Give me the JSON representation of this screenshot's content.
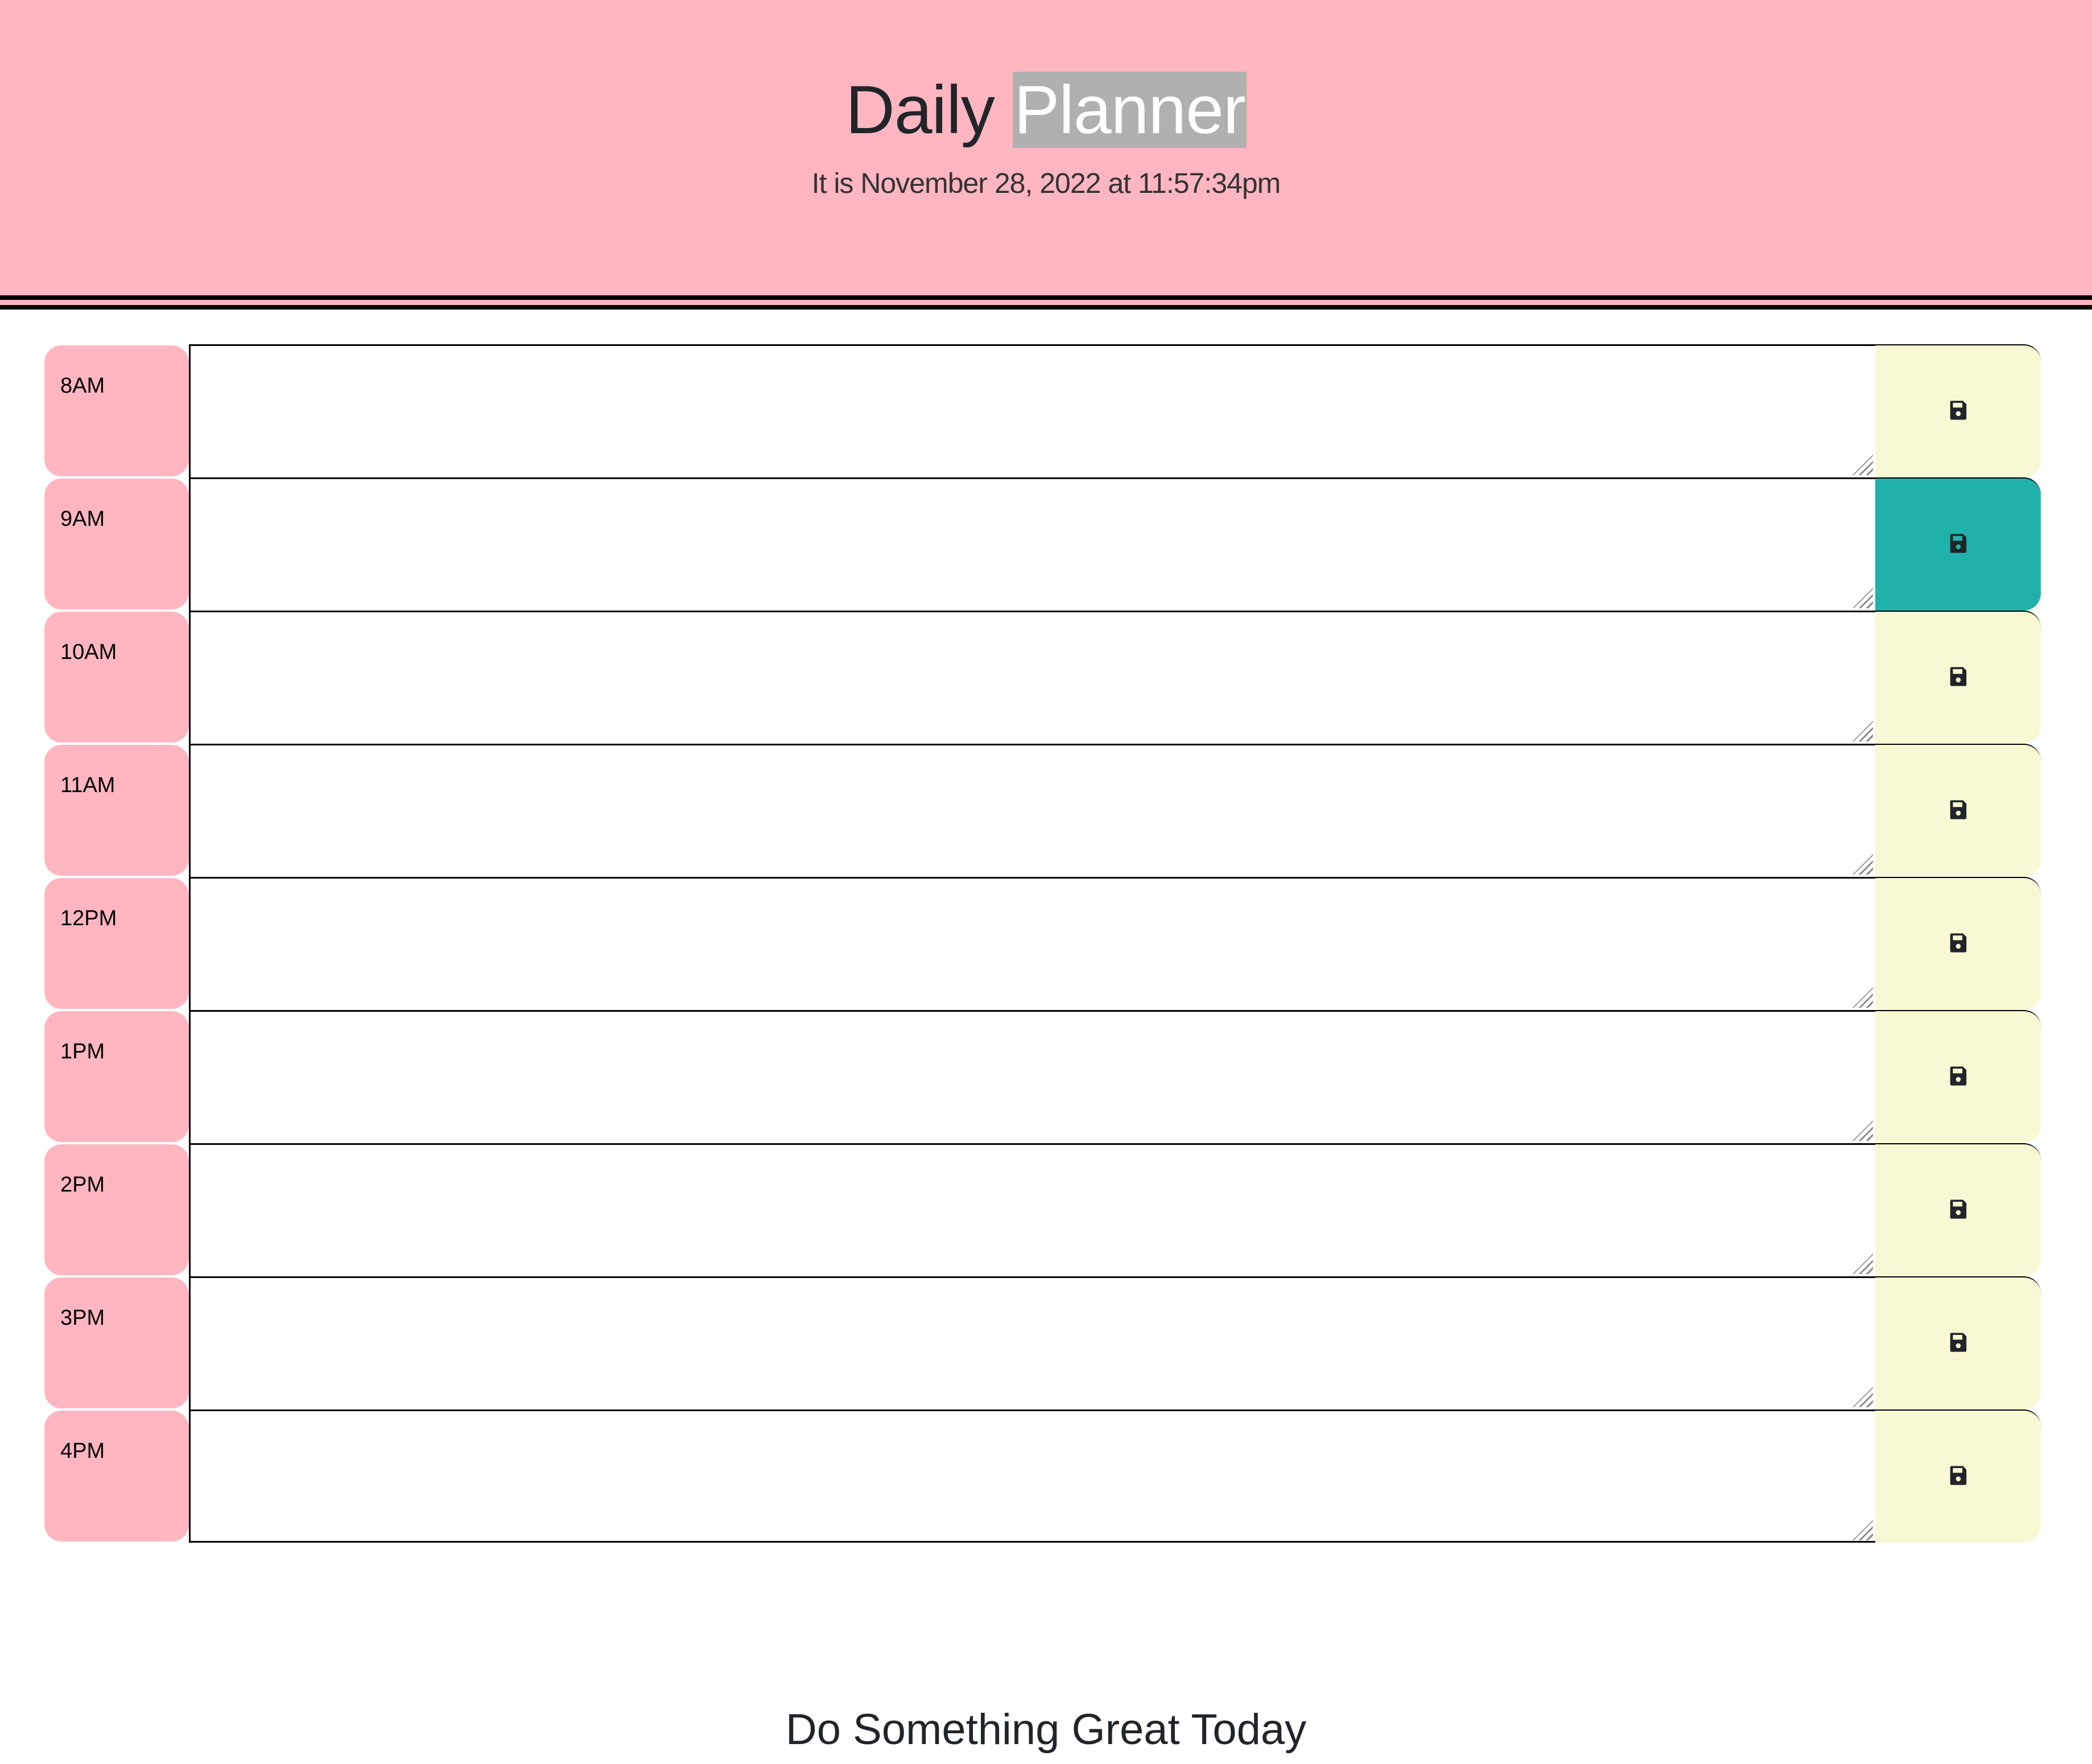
{
  "header": {
    "title_part1": "Daily",
    "title_part2": "Planner",
    "current_datetime": "It is November 28, 2022 at 11:57:34pm"
  },
  "colors": {
    "header_bg": "#FFB6C1",
    "hour_bg": "#FFB6C1",
    "future_button": "#F8F8D4",
    "current_button": "#20B2AA"
  },
  "rows": [
    {
      "hour": "8AM",
      "text": "",
      "state": "future"
    },
    {
      "hour": "9AM",
      "text": "",
      "state": "current"
    },
    {
      "hour": "10AM",
      "text": "",
      "state": "future"
    },
    {
      "hour": "11AM",
      "text": "",
      "state": "future"
    },
    {
      "hour": "12PM",
      "text": "",
      "state": "future"
    },
    {
      "hour": "1PM",
      "text": "",
      "state": "future"
    },
    {
      "hour": "2PM",
      "text": "",
      "state": "future"
    },
    {
      "hour": "3PM",
      "text": "",
      "state": "future"
    },
    {
      "hour": "4PM",
      "text": "",
      "state": "future"
    }
  ],
  "save_icon": "floppy-disk-icon",
  "footer": {
    "text": "Do Something Great Today"
  }
}
